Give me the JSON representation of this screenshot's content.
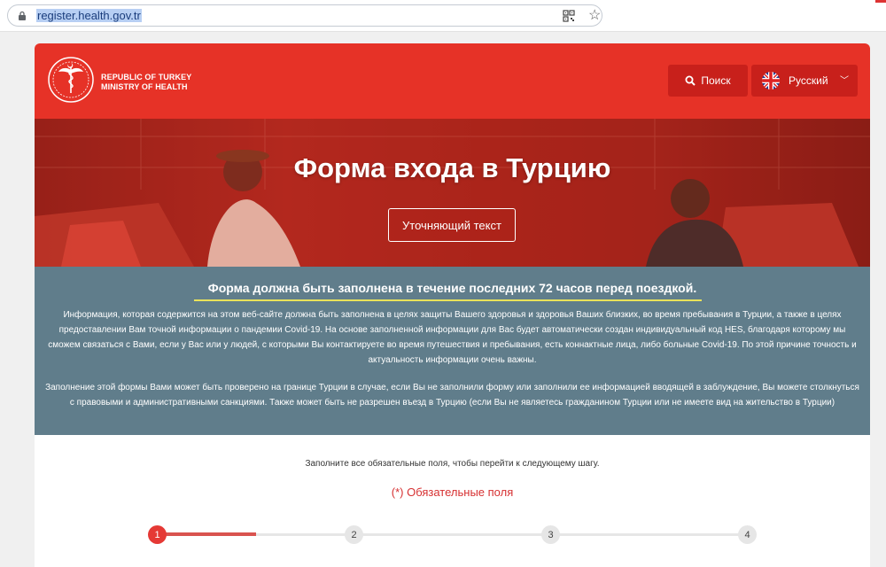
{
  "browser": {
    "url": "register.health.gov.tr"
  },
  "header": {
    "logo_line1": "REPUBLIC OF TURKEY",
    "logo_line2": "MINISTRY OF HEALTH",
    "search_label": "Поиск",
    "language_label": "Русский"
  },
  "hero": {
    "title": "Форма входа в Турцию",
    "button_label": "Уточняющий текст"
  },
  "info": {
    "notice": "Форма должна быть заполнена в течение последних 72 часов перед поездкой.",
    "paragraph1": "Информация, которая содержится на этом веб-сайте должна быть заполнена в целях защиты Вашего здоровья и здоровья Ваших близких, во время пребывания в Турции, а также в целях предоставлении Вам точной информации о пандемии Covid-19. На основе заполненной информации для Вас будет автоматически создан индивидуальный код HES, благодаря которому мы сможем связаться с Вами, если у Вас или у людей, с которыми Вы контактируете во время путешествия и пребывания, есть коннактные лица, либо больные Covid-19. По этой причине точность и актуальность информации очень важны.",
    "paragraph2": "Заполнение этой формы Вами может быть проверено на границе Турции в случае, если Вы не заполнили форму или заполнили ее информацией вводящей в заблуждение, Вы можете столкнуться с правовыми и административными санкциями. Также может быть не разрешен въезд в Турцию (если Вы не являетесь гражданином Турции или не имеете вид на жительство в Турции)"
  },
  "form": {
    "fill_note": "Заполните все обязательные поля, чтобы перейти к следующему шагу.",
    "required_note": "(*) Обязательные поля",
    "steps": [
      "1",
      "2",
      "3",
      "4"
    ],
    "current_step": 1
  },
  "colors": {
    "brand_red": "#e63227",
    "button_red": "#c8201b",
    "info_band": "#607d8b",
    "notice_underline": "#e9e25a",
    "step_active": "#e53935"
  }
}
